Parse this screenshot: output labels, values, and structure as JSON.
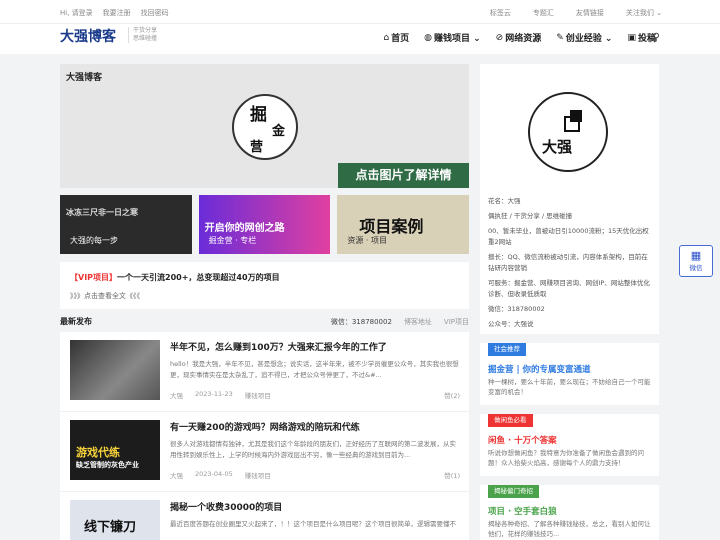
{
  "topbar": {
    "left": [
      "Hi, 请登录",
      "我要注册",
      "找回密码"
    ],
    "right": [
      "标签云",
      "专题汇",
      "友情链接",
      "关注我们 ⌄"
    ]
  },
  "nav": {
    "logo": "大强博客",
    "sub1": "干货分享",
    "sub2": "思维碰撞",
    "menu": [
      {
        "icon": "home-icon",
        "label": "首页"
      },
      {
        "icon": "globe-icon",
        "label": "赚钱项目 ⌄"
      },
      {
        "icon": "compass-icon",
        "label": "网络资源"
      },
      {
        "icon": "pencil-icon",
        "label": "创业经验 ⌄"
      },
      {
        "icon": "edit-icon",
        "label": "投稿"
      }
    ]
  },
  "banner": {
    "brand": "大强博客",
    "c1": "掘",
    "c2": "金",
    "c3": "营",
    "cta": "点击图片了解详情"
  },
  "thumbs": [
    {
      "big": "冰冻三尺非一日之寒",
      "cap": "大强的每一步"
    },
    {
      "big": "开启你的网创之路",
      "cap": "掘金营 · 专栏"
    },
    {
      "big": "项目案例",
      "cap": "资源 · 项目"
    }
  ],
  "vip": {
    "tag": "【VIP项目】",
    "title": "一个一天引流200+，总变现超过40万的项目",
    "more": "》》》点击查看全文《《《"
  },
  "section": {
    "title": "最新发布",
    "wechat": "微信：318780002",
    "links": [
      "博客地址",
      "VIP项目"
    ]
  },
  "posts": [
    {
      "title": "半年不见，怎么赚到100万？大强来汇报今年的工作了",
      "desc": "hello！我是大强，半年不见，甚是想念；说实话，这半年来，被不少学员催更公众号，其实我也很想更，现实事情实在是太杂乱了，追不得已，才把公众号停更了，不过&#...",
      "author": "大强",
      "date": "2023-11-23",
      "cat": "赚钱项目",
      "likes": "赞(2)"
    },
    {
      "title": "有一天赚200的游戏吗？网络游戏的陪玩和代练",
      "desc": "很多人对游戏都情有独钟，尤其是我们这个年龄段的朋友们，正好经历了互联网的第二波发展，从实用性转到娱乐性上，上学的时候海内外游戏层出不穷，像一些经典的游戏到目前为...",
      "author": "大强",
      "date": "2023-04-05",
      "cat": "赚钱项目",
      "likes": "赞(1)",
      "img_p": "游戏代练",
      "img_s": "缺乏管制的灰色产业"
    },
    {
      "title": "揭秘一个收费30000的项目",
      "desc": "最近百度答题在创业圈里又火起来了，！！这个项目是什么项目呢？这个项目很简单，逻辑需要懂不",
      "img_p": "线下镰刀"
    }
  ],
  "profile": {
    "logo_text": "大强",
    "lines": [
      "花名：大强",
      "偶执狂 / 干货分享 / 思维碰撞",
      "00、暂未毕业，曾被动日引10000流粉；15天优化出权重2网站",
      "擅长：QQ、微信流粉被动引流，内容体系架构，目前在钻研内容营销",
      "可服务：掘金营、网赚项目咨询、网创IP、网站整体优化诊断、但收录低质取",
      "微信：318780002",
      "公众号：大强说"
    ]
  },
  "cards": [
    {
      "badge": "社会推荐",
      "color": "#2f7be0",
      "title": "掘金营 | 你的专属变富通道",
      "title_color": "#2f7be0",
      "desc": "种一棵树，要么十年前，要么现在；不妨给自己一个可能变富的机会！"
    },
    {
      "badge": "做闲鱼必看",
      "color": "#e33",
      "title": "闲鱼 · 十万个答案",
      "title_color": "#e33",
      "desc": "听说你想做闲鱼？我特意为你准备了做闲鱼会遇到的问题！众人拾柴火焰高，感谢每个人的鼎力支持！"
    },
    {
      "badge": "揭秘偏门奇招",
      "color": "#4aa34a",
      "title": "项目 · 空手套白狼",
      "title_color": "#4aa34a",
      "desc": "揭秘各种奇招、了解各种赚钱秘技，总之，看别人如何让他们，花样的赚钱技巧..."
    }
  ],
  "float": {
    "label": "微信"
  }
}
